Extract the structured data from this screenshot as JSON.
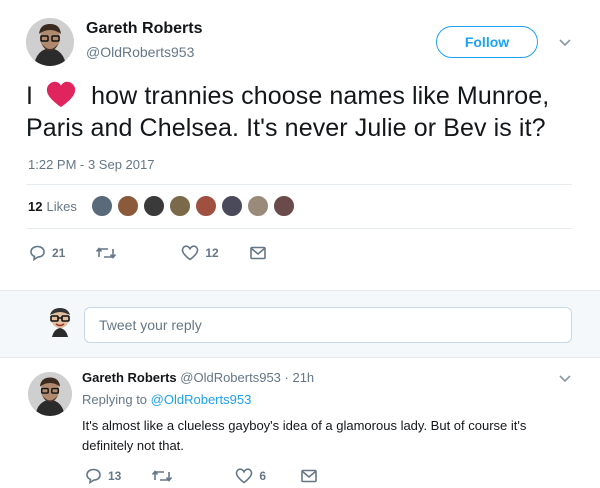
{
  "tweet": {
    "author_name": "Gareth Roberts",
    "author_handle": "@OldRoberts953",
    "follow_label": "Follow",
    "text_before": "I",
    "text_after": "how trannies choose names like Munroe, Paris and Chelsea. It's never Julie or Bev is it?",
    "timestamp": "1:22 PM - 3 Sep 2017",
    "likes_count": "12",
    "likes_label": "Likes",
    "reply_count": "21",
    "like_count": "12"
  },
  "compose": {
    "placeholder": "Tweet your reply"
  },
  "reply": {
    "author_name": "Gareth Roberts",
    "author_handle": "@OldRoberts953",
    "time": "· 21h",
    "replying_prefix": "Replying to",
    "replying_handle": "@OldRoberts953",
    "text": "It's almost like a clueless gayboy's idea of a glamorous lady. But of course it's definitely not that.",
    "reply_count": "13",
    "like_count": "6"
  },
  "colors": {
    "accent": "#1da1f2",
    "heart": "#e0245e",
    "muted": "#657786",
    "divider": "#e6ecf0"
  },
  "icons": [
    "chevron-down-icon",
    "heart-icon",
    "reply-icon",
    "retweet-icon",
    "like-icon",
    "message-icon"
  ]
}
